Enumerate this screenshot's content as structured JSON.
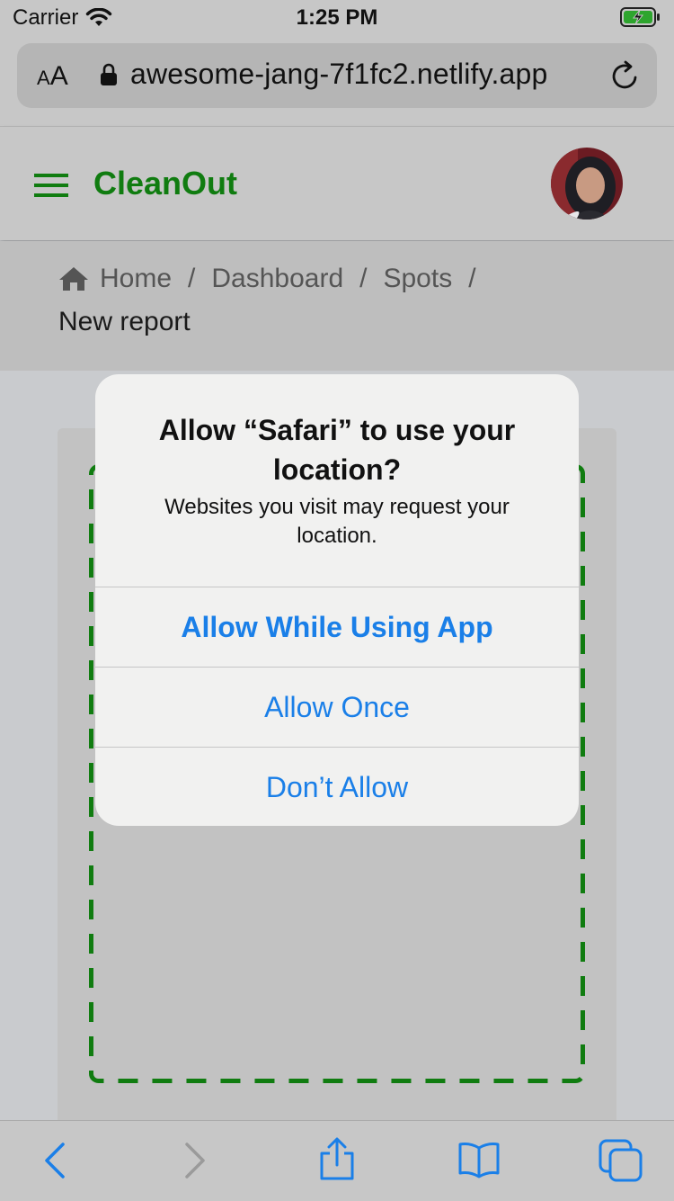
{
  "status_bar": {
    "carrier": "Carrier",
    "time": "1:25 PM"
  },
  "browser": {
    "text_size_label": "AA",
    "url": "awesome-jang-7f1fc2.netlify.app"
  },
  "app": {
    "brand": "CleanOut"
  },
  "breadcrumb": {
    "home": "Home",
    "dashboard": "Dashboard",
    "spots": "Spots",
    "current": "New report",
    "separator": "/"
  },
  "dialog": {
    "title": "Allow “Safari” to use your location?",
    "message": "Websites you visit may request your location.",
    "allow_while_using": "Allow While Using App",
    "allow_once": "Allow Once",
    "dont_allow": "Don’t Allow"
  },
  "colors": {
    "brand_green": "#107c10",
    "ios_blue": "#1a7fe8"
  }
}
